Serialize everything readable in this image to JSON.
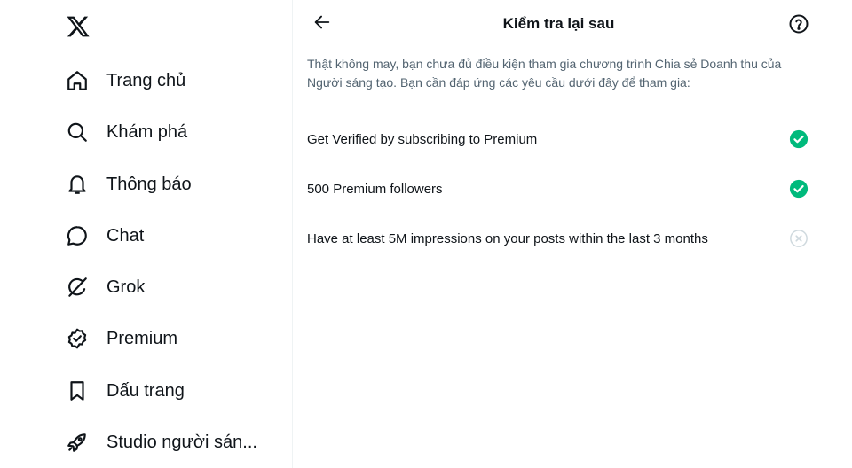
{
  "sidebar": {
    "logo_icon": "x-logo-icon",
    "items": [
      {
        "label": "Trang chủ",
        "icon": "home-icon"
      },
      {
        "label": "Khám phá",
        "icon": "search-icon"
      },
      {
        "label": "Thông báo",
        "icon": "bell-icon"
      },
      {
        "label": "Chat",
        "icon": "chat-bubble-icon"
      },
      {
        "label": "Grok",
        "icon": "grok-icon"
      },
      {
        "label": "Premium",
        "icon": "verified-badge-icon"
      },
      {
        "label": "Dấu trang",
        "icon": "bookmark-icon"
      },
      {
        "label": "Studio người sán...",
        "icon": "rocket-icon"
      }
    ]
  },
  "header": {
    "title": "Kiểm tra lại sau",
    "back_icon": "arrow-left-icon",
    "help_icon": "help-circle-icon"
  },
  "intro_text": "Thật không may, bạn chưa đủ điều kiện tham gia chương trình Chia sẻ Doanh thu của Người sáng tạo. Bạn cần đáp ứng các yêu cầu dưới đây để tham gia:",
  "requirements": [
    {
      "text": "Get Verified by subscribing to Premium",
      "met": true
    },
    {
      "text": "500 Premium followers",
      "met": true
    },
    {
      "text": "Have at least 5M impressions on your posts within the last 3 months",
      "met": false
    }
  ],
  "colors": {
    "success": "#00ba7c",
    "unmet": "#cfd9de",
    "secondary_text": "#536471"
  }
}
